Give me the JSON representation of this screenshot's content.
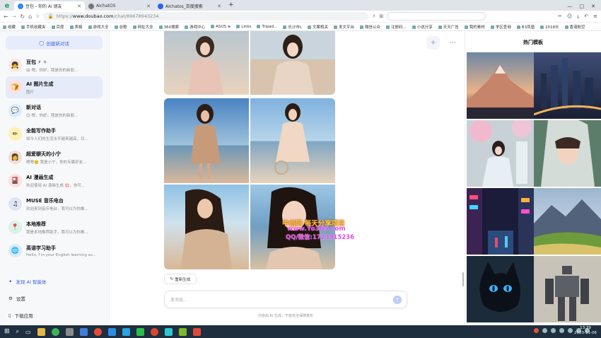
{
  "browser": {
    "tabs": [
      {
        "label": "豆包 - 你的 AI 朋友",
        "color": "#2a8cf0",
        "active": true
      },
      {
        "label": "AIchatOS",
        "color": "#555"
      },
      {
        "label": "AIchatos_百度搜索",
        "color": "#3062e8"
      }
    ],
    "url_prefix": "https://",
    "url_domain": "www.doubao.com",
    "url_path": "/chat/89678943234",
    "search_placeholder": "..."
  },
  "bookmarks": [
    "收藏",
    "手机收藏夹",
    "百度",
    "表格",
    "游戏大全",
    "谷歌",
    "网址大全",
    "360搜索",
    "游戏中心",
    "ASUS ≡",
    "Links",
    "Tripad...",
    "长沙市L",
    "文案相关",
    "发文平台",
    "微信公众",
    "注册码...",
    "小说分享",
    "天天广告",
    "我的素材",
    "学区查询",
    "B3凤凰",
    "2018长",
    "香港航空"
  ],
  "sidebar": {
    "new_chat": "创建新对话",
    "bots": [
      {
        "name": "豆包 ⚡ ✧",
        "desc": "😆 嗯，你好，我是你的新朋...",
        "avatar": "👧",
        "bg": "#f5e9e2"
      },
      {
        "name": "AI 图片生成",
        "desc": "图片",
        "avatar": "🍞",
        "bg": "#ffe2d6"
      },
      {
        "name": "新对话",
        "desc": "😊 嗯，你好，我是你的新朋...",
        "avatar": "💬",
        "bg": "#d9ecff"
      },
      {
        "name": "全能写作助手",
        "desc": "如今人们的生活水平越来越高，日...",
        "avatar": "✏",
        "bg": "#fff0b3"
      },
      {
        "name": "超爱聊天的小宁",
        "desc": "嗯嗯🙂 我是小宁，你的专属好友...",
        "avatar": "👩",
        "bg": "#f1dcd2"
      },
      {
        "name": "AI 漫画生成",
        "desc": "欢迎使用 AI 漫画生成 💢，你可...",
        "avatar": "🎴",
        "bg": "#ffdde0"
      },
      {
        "name": "MUSE 音乐电台",
        "desc": "欢迎来到音乐电台，我可以为你推...",
        "avatar": "♫",
        "bg": "#e0e4f5"
      },
      {
        "name": "本地推荐",
        "desc": "我是本地推荐助手，我可以为你推...",
        "avatar": "📍",
        "bg": "#d9f3e6"
      },
      {
        "name": "英语学习助手",
        "desc": "Hello, I'm your English learning as...",
        "avatar": "🌐",
        "bg": "#dbe9fb"
      }
    ],
    "discover": "发现 AI 智能体",
    "settings": "设置",
    "download": "下载应用"
  },
  "main": {
    "regenerate": "重新生成",
    "input_placeholder": "发消息...",
    "disclaimer": "内容由 AI 生成，不能完全保障真实",
    "watermark": [
      "中创网 每天分享项目",
      "www.Yo365.com",
      "QQ/微信:1723915236"
    ]
  },
  "templates": {
    "title": "热门模板"
  },
  "tray": {
    "time": "13:39",
    "date": "2023-11-06"
  }
}
